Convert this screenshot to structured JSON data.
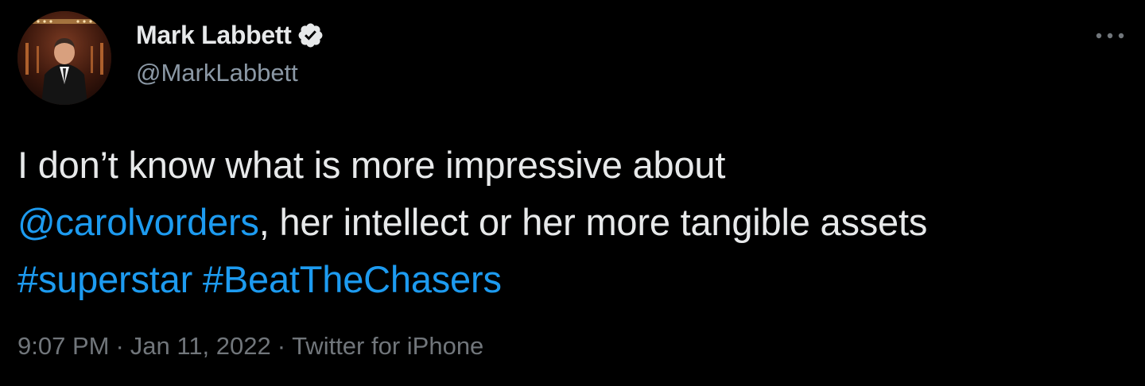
{
  "author": {
    "display_name": "Mark Labbett",
    "handle": "@MarkLabbett",
    "verified": true,
    "avatar_icon": "avatar-photo"
  },
  "menu": {
    "icon": "more-horizontal-icon"
  },
  "tweet": {
    "line1": "I don’t know what is more impressive about",
    "mention": "@carolvorders",
    "line2_rest": ", her intellect or her more tangible assets",
    "hashtag1": "#superstar",
    "hashtag2": "#BeatTheChasers"
  },
  "meta": {
    "time": "9:07 PM",
    "date": "Jan 11, 2022",
    "source": "Twitter for iPhone",
    "separator": "·"
  },
  "colors": {
    "background": "#000000",
    "text": "#e7e9ea",
    "secondary": "#71767b",
    "link": "#1d9bf0"
  }
}
